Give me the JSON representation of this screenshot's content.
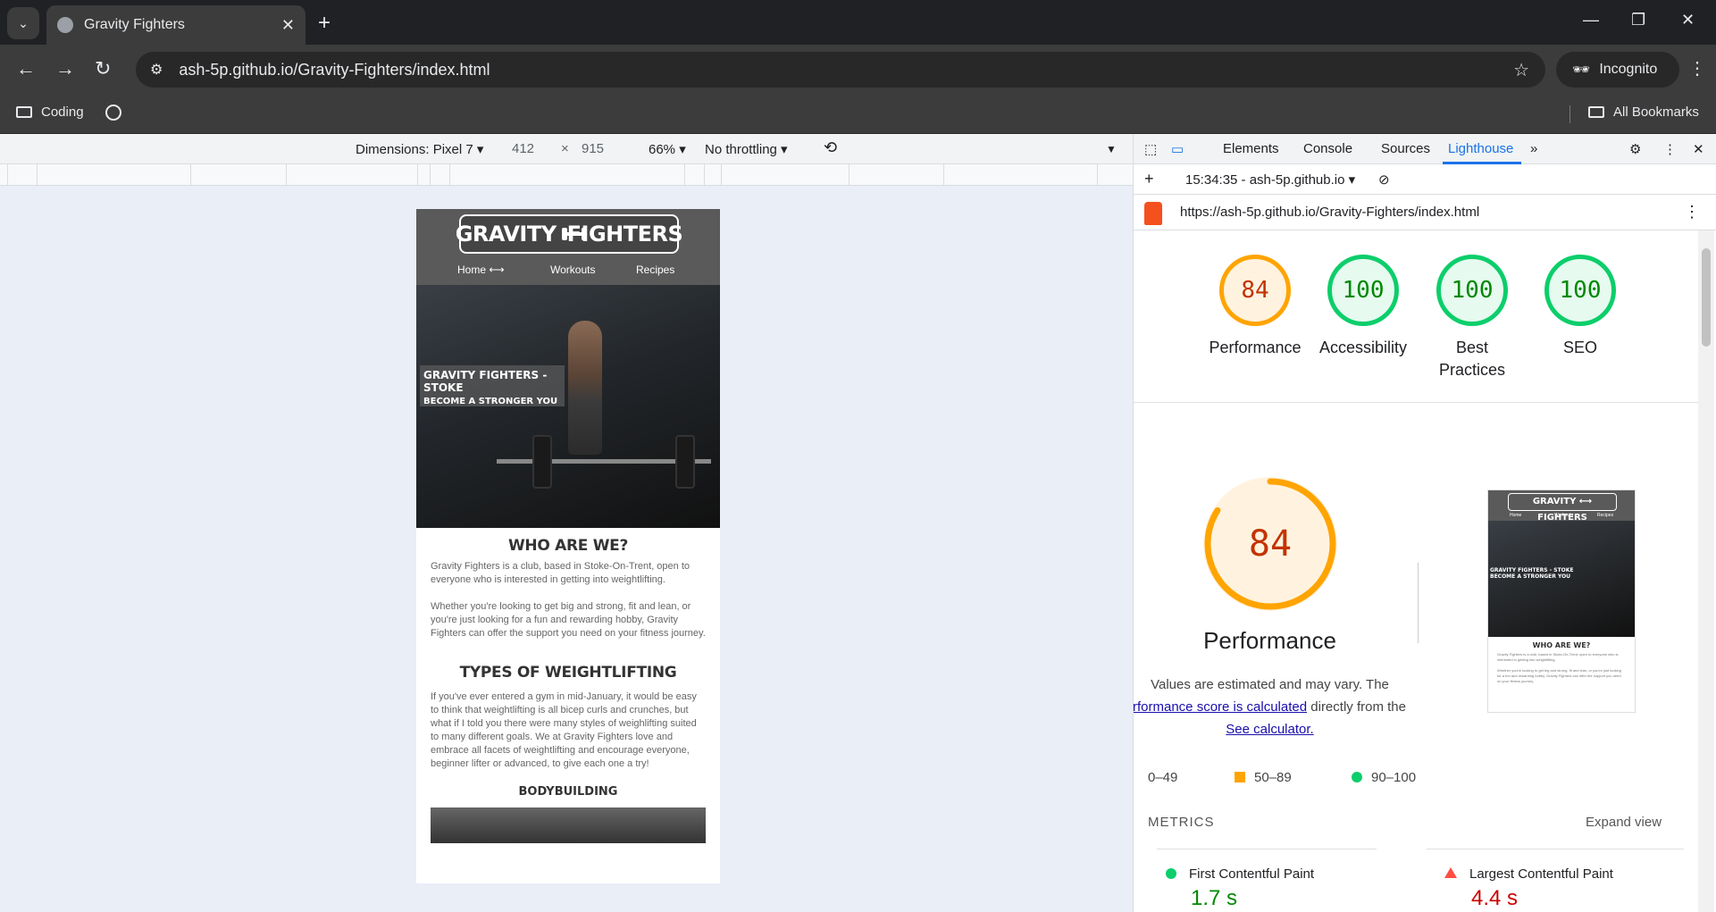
{
  "browser": {
    "tab_title": "Gravity Fighters",
    "url": "ash-5p.github.io/Gravity-Fighters/index.html",
    "incognito_label": "Incognito",
    "bookmarks": [
      {
        "label": "Coding"
      }
    ],
    "all_bookmarks_label": "All Bookmarks"
  },
  "device_toolbar": {
    "dimensions_label": "Dimensions: Pixel 7",
    "width": "412",
    "times": "×",
    "height": "915",
    "zoom": "66%",
    "throttling": "No throttling"
  },
  "site": {
    "logo_left": "GRAVITY",
    "logo_right": "FIGHTERS",
    "nav": [
      "Home",
      "Workouts",
      "Recipes"
    ],
    "hero_line1": "GRAVITY FIGHTERS - STOKE",
    "hero_line2": "BECOME A STRONGER YOU",
    "who_heading": "WHO ARE WE?",
    "who_p1": "Gravity Fighters is a club, based in Stoke-On-Trent, open to everyone who is interested in getting into weightlifting.",
    "who_p2": "Whether you're looking to get big and strong, fit and lean, or you're just looking for a fun and rewarding hobby, Gravity Fighters can offer the support you need on your fitness journey.",
    "types_heading": "TYPES OF WEIGHTLIFTING",
    "types_p": "If you've ever entered a gym in mid-January, it would be easy to think that weightlifting is all bicep curls and crunches, but what if I told you there were many styles of weighlifting suited to many different goals. We at Gravity Fighters love and embrace all facets of weightlifting and encourage everyone, beginner lifter or advanced, to give each one a try!",
    "bodybuilding_heading": "BODYBUILDING"
  },
  "devtools": {
    "tabs": [
      "Elements",
      "Console",
      "Sources",
      "Lighthouse"
    ],
    "active_tab": "Lighthouse",
    "report_label": "15:34:35 - ash-5p.github.io",
    "report_url": "https://ash-5p.github.io/Gravity-Fighters/index.html"
  },
  "lighthouse": {
    "scores": [
      {
        "label": "Performance",
        "value": "84",
        "status": "average"
      },
      {
        "label": "Accessibility",
        "value": "100",
        "status": "pass"
      },
      {
        "label": "Best Practices",
        "value": "100",
        "status": "pass"
      },
      {
        "label": "SEO",
        "value": "100",
        "status": "pass"
      }
    ],
    "performance_score": "84",
    "performance_score_fraction": 0.84,
    "performance_title": "Performance",
    "desc_text1": "Values are estimated and may vary. The",
    "desc_link1": "rformance score is calculated",
    "desc_text2": "directly from these metrics.",
    "desc_link2": "See calculator.",
    "legend": [
      "0–49",
      "50–89",
      "90–100"
    ],
    "metrics_heading": "METRICS",
    "expand_label": "Expand view",
    "metrics": [
      {
        "label": "First Contentful Paint",
        "value": "1.7 s",
        "status": "pass"
      },
      {
        "label": "Largest Contentful Paint",
        "value": "4.4 s",
        "status": "fail"
      }
    ]
  },
  "colors": {
    "pass": "#0cce6b",
    "average": "#ffa400",
    "fail": "#ff4e42",
    "devtools_accent": "#1a73e8"
  }
}
